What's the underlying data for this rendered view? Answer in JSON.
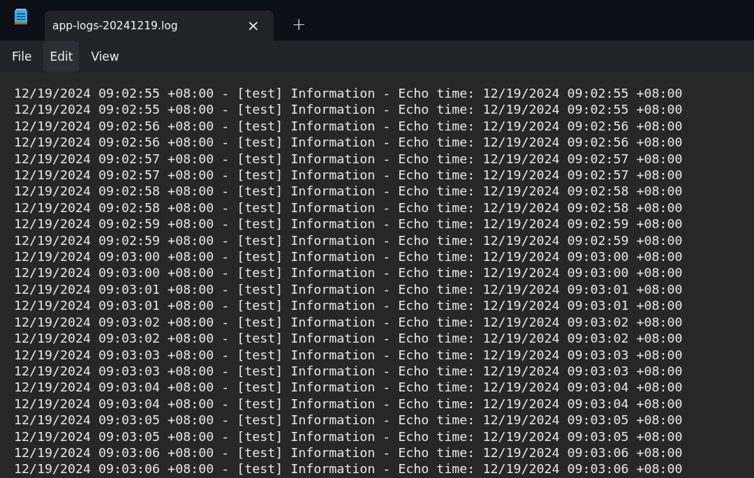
{
  "tab": {
    "title": "app-logs-20241219.log",
    "close": "×",
    "new_tab": "+"
  },
  "menu": [
    {
      "label": "File",
      "highlighted": false
    },
    {
      "label": "Edit",
      "highlighted": true
    },
    {
      "label": "View",
      "highlighted": false
    }
  ],
  "lines": [
    "12/19/2024 09:02:55 +08:00 - [test] Information - Echo time: 12/19/2024 09:02:55 +08:00",
    "12/19/2024 09:02:55 +08:00 - [test] Information - Echo time: 12/19/2024 09:02:55 +08:00",
    "12/19/2024 09:02:56 +08:00 - [test] Information - Echo time: 12/19/2024 09:02:56 +08:00",
    "12/19/2024 09:02:56 +08:00 - [test] Information - Echo time: 12/19/2024 09:02:56 +08:00",
    "12/19/2024 09:02:57 +08:00 - [test] Information - Echo time: 12/19/2024 09:02:57 +08:00",
    "12/19/2024 09:02:57 +08:00 - [test] Information - Echo time: 12/19/2024 09:02:57 +08:00",
    "12/19/2024 09:02:58 +08:00 - [test] Information - Echo time: 12/19/2024 09:02:58 +08:00",
    "12/19/2024 09:02:58 +08:00 - [test] Information - Echo time: 12/19/2024 09:02:58 +08:00",
    "12/19/2024 09:02:59 +08:00 - [test] Information - Echo time: 12/19/2024 09:02:59 +08:00",
    "12/19/2024 09:02:59 +08:00 - [test] Information - Echo time: 12/19/2024 09:02:59 +08:00",
    "12/19/2024 09:03:00 +08:00 - [test] Information - Echo time: 12/19/2024 09:03:00 +08:00",
    "12/19/2024 09:03:00 +08:00 - [test] Information - Echo time: 12/19/2024 09:03:00 +08:00",
    "12/19/2024 09:03:01 +08:00 - [test] Information - Echo time: 12/19/2024 09:03:01 +08:00",
    "12/19/2024 09:03:01 +08:00 - [test] Information - Echo time: 12/19/2024 09:03:01 +08:00",
    "12/19/2024 09:03:02 +08:00 - [test] Information - Echo time: 12/19/2024 09:03:02 +08:00",
    "12/19/2024 09:03:02 +08:00 - [test] Information - Echo time: 12/19/2024 09:03:02 +08:00",
    "12/19/2024 09:03:03 +08:00 - [test] Information - Echo time: 12/19/2024 09:03:03 +08:00",
    "12/19/2024 09:03:03 +08:00 - [test] Information - Echo time: 12/19/2024 09:03:03 +08:00",
    "12/19/2024 09:03:04 +08:00 - [test] Information - Echo time: 12/19/2024 09:03:04 +08:00",
    "12/19/2024 09:03:04 +08:00 - [test] Information - Echo time: 12/19/2024 09:03:04 +08:00",
    "12/19/2024 09:03:05 +08:00 - [test] Information - Echo time: 12/19/2024 09:03:05 +08:00",
    "12/19/2024 09:03:05 +08:00 - [test] Information - Echo time: 12/19/2024 09:03:05 +08:00",
    "12/19/2024 09:03:06 +08:00 - [test] Information - Echo time: 12/19/2024 09:03:06 +08:00",
    "12/19/2024 09:03:06 +08:00 - [test] Information - Echo time: 12/19/2024 09:03:06 +08:00"
  ]
}
